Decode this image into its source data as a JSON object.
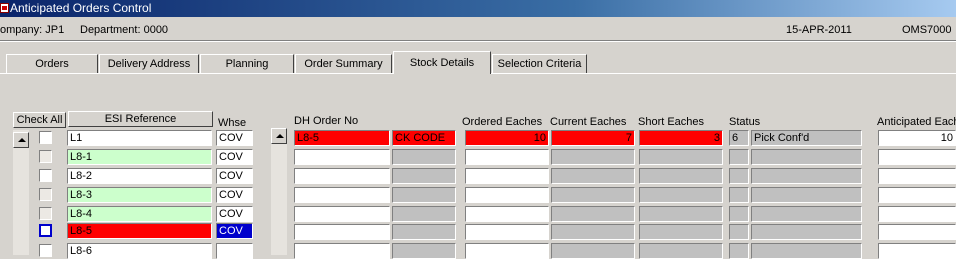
{
  "window": {
    "title": "Anticipated Orders Control",
    "app_icon": "oracle-forms-icon"
  },
  "info": {
    "company": "ompany: JP1",
    "department": "Department: 0000",
    "date": "15-APR-2011",
    "module": "OMS7000"
  },
  "tabs": [
    "Orders",
    "Delivery Address",
    "Planning",
    "Order Summary",
    "Stock Details",
    "Selection Criteria"
  ],
  "active_tab": "Stock Details",
  "left_grid": {
    "check_all": "Check All",
    "esi_header": "ESI Reference",
    "whse_header": "Whse",
    "rows": [
      {
        "ref": "L1",
        "whse": "COV"
      },
      {
        "ref": "L8-1",
        "whse": "COV"
      },
      {
        "ref": "L8-2",
        "whse": "COV"
      },
      {
        "ref": "L8-3",
        "whse": "COV"
      },
      {
        "ref": "L8-4",
        "whse": "COV"
      },
      {
        "ref": "L8-5",
        "whse": "COV"
      },
      {
        "ref": "L8-6",
        "whse": ""
      }
    ]
  },
  "right_grid": {
    "headers": {
      "dh_order": "DH Order No",
      "ordered": "Ordered Eaches",
      "current": "Current Eaches",
      "short": "Short Eaches",
      "status": "Status",
      "anticipated": "Anticipated Each"
    },
    "first_row": {
      "dh_order": "L8-5",
      "code": "CK CODE",
      "ordered": "10",
      "current": "7",
      "short": "3",
      "status_code": "6",
      "status_text": "Pick Conf'd",
      "anticipated": "10"
    }
  }
}
